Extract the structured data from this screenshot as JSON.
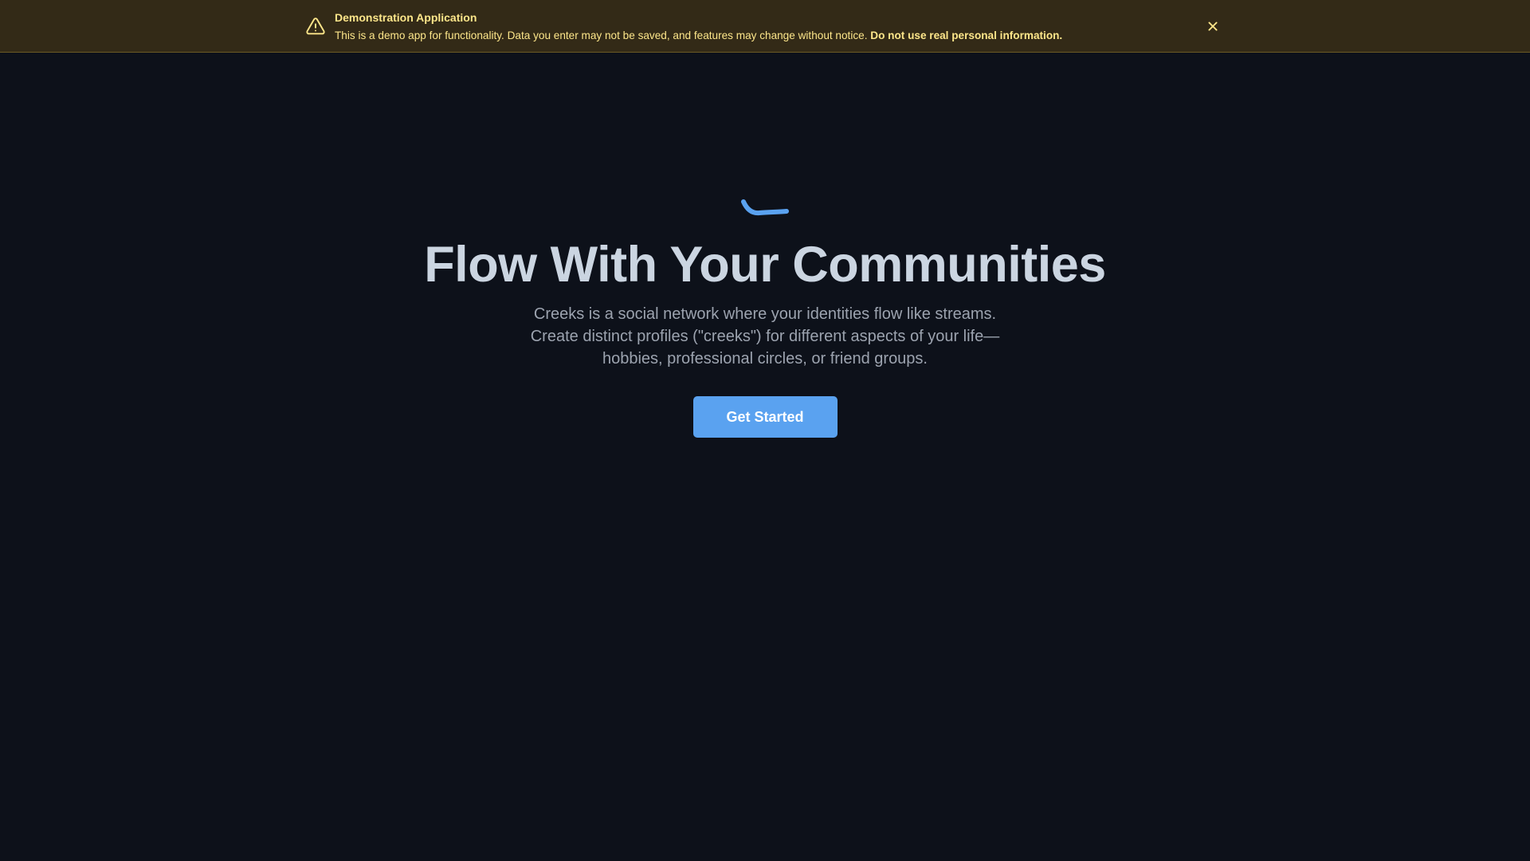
{
  "banner": {
    "title": "Demonstration Application",
    "message": "This is a demo app for functionality. Data you enter may not be saved, and features may change without notice.",
    "message_bold": "Do not use real personal information.",
    "icon": "warning-triangle-icon",
    "close_icon": "close-icon",
    "background_color": "#332a17",
    "text_color": "#fde68a"
  },
  "hero": {
    "logo_icon": "creek-wave-icon",
    "title": "Flow With Your Communities",
    "description_lines": [
      "Creeks is a social network where your identities flow like streams.",
      "Create distinct profiles (\"creeks\") for different aspects of your life—",
      "hobbies, professional circles, or friend groups."
    ],
    "cta_label": "Get Started",
    "accent_color": "#5aa2f0"
  }
}
